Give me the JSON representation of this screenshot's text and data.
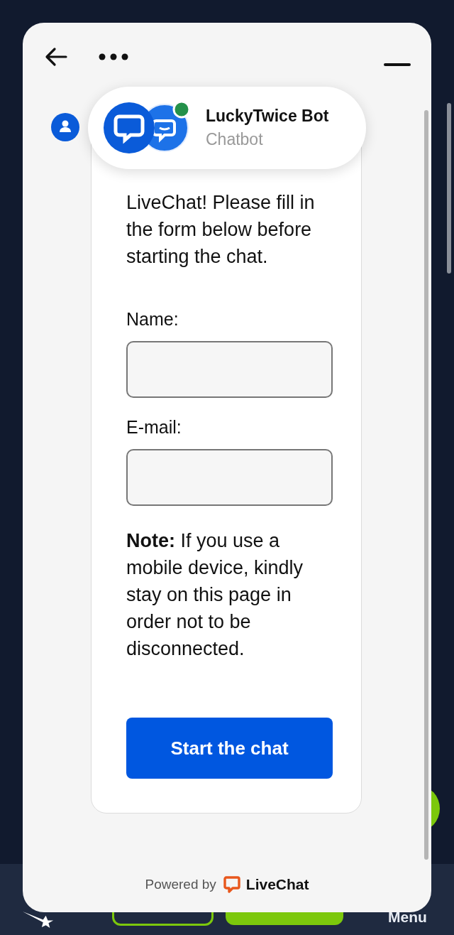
{
  "agent": {
    "name": "LuckyTwice Bot",
    "role": "Chatbot",
    "online": true
  },
  "message": {
    "text": "LiveChat! Please fill in the form below before starting the chat.",
    "fields": [
      {
        "label": "Name:"
      },
      {
        "label": "E-mail:"
      }
    ],
    "note": "**Note:** If you use a mobile device, kindly stay on this page in order not to be disconnected.",
    "button": "Start the chat"
  },
  "footer": {
    "powered": "Powered by",
    "brand": "LiveChat"
  },
  "page": {
    "menu_label": "Menu"
  }
}
